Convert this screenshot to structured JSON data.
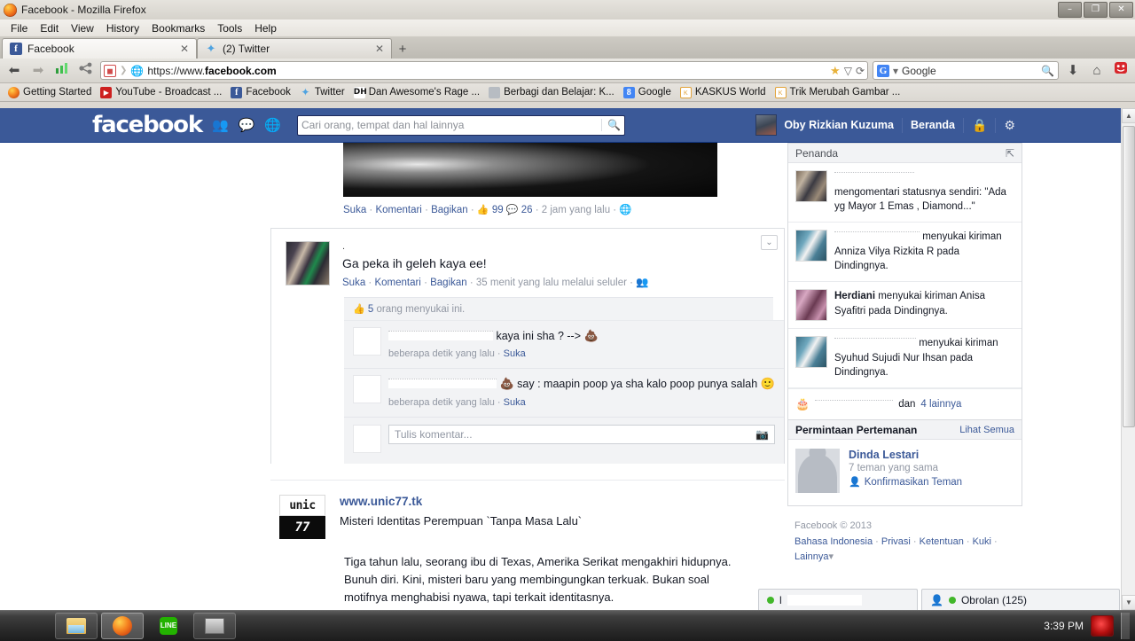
{
  "window": {
    "title": "Facebook - Mozilla Firefox",
    "minimize": "–",
    "maximize": "❐",
    "close": "✕"
  },
  "menubar": [
    "File",
    "Edit",
    "View",
    "History",
    "Bookmarks",
    "Tools",
    "Help"
  ],
  "tabs": [
    {
      "label": "Facebook",
      "icon": "facebook-icon",
      "close": "✕",
      "active": true
    },
    {
      "label": "(2) Twitter",
      "icon": "twitter-icon",
      "close": "✕",
      "active": false
    }
  ],
  "newtab_label": "+",
  "navbar": {
    "back": "⬅",
    "forward": "➡",
    "url": "https://www.",
    "url_bold": "facebook.com",
    "url_suffix": "",
    "identity_icon": "site-identity-icon",
    "star": "★",
    "dropmarker": "▽",
    "reload": "⟳",
    "search_engine": "Google",
    "search_icon": "magnifier-icon",
    "download": "⬇",
    "home": "⌂"
  },
  "bookmarks": [
    {
      "label": "Getting Started",
      "icon": "firefox-icon"
    },
    {
      "label": "YouTube - Broadcast ...",
      "icon": "youtube-icon"
    },
    {
      "label": "Facebook",
      "icon": "facebook-icon"
    },
    {
      "label": "Twitter",
      "icon": "twitter-icon"
    },
    {
      "label": "Dan Awesome's Rage ...",
      "icon": "rage-icon"
    },
    {
      "label": "Berbagi dan Belajar: K...",
      "icon": "blog-icon"
    },
    {
      "label": "Google",
      "icon": "google-icon"
    },
    {
      "label": "KASKUS World",
      "icon": "kaskus-icon"
    },
    {
      "label": "Trik Merubah Gambar ...",
      "icon": "kaskus-icon"
    }
  ],
  "fb_header": {
    "logo": "facebook",
    "icons": [
      "friend-requests-icon",
      "messages-icon",
      "notifications-icon"
    ],
    "search_placeholder": "Cari orang, tempat dan hal lainnya",
    "search_button": "search-icon",
    "user_name": "Oby Rizkian Kuzuma",
    "home_label": "Beranda",
    "privacy_icon": "privacy-lock-icon",
    "settings_icon": "gear-icon",
    "brand_color": "#3b5998"
  },
  "feed": {
    "photo_post": {
      "like": "Suka",
      "comment": "Komentari",
      "share": "Bagikan",
      "like_count": "99",
      "comment_count": "26",
      "time": "2 jam yang lalu",
      "privacy_icon": "globe-icon"
    },
    "status_post": {
      "dot": ".",
      "text": "Ga peka ih geleh kaya ee!",
      "like": "Suka",
      "comment": "Komentari",
      "share": "Bagikan",
      "time": "35 menit yang lalu melalui seluler",
      "privacy_icon": "friends-icon",
      "caret": "⌄",
      "likes_summary_count": "5",
      "likes_summary_text": " orang menyukai ini.",
      "comments": [
        {
          "author": "",
          "text": "kaya ini sha ? -->",
          "emoji": "💩",
          "time": "beberapa detik yang lalu",
          "like": "Suka"
        },
        {
          "author": "",
          "emoji": "💩",
          "text": "say : maapin poop ya sha kalo poop punya salah",
          "emoji2": "🙂",
          "time": "beberapa detik yang lalu",
          "like": "Suka"
        }
      ],
      "comment_placeholder": "Tulis komentar...",
      "camera_icon": "camera-icon"
    },
    "link_post": {
      "logo_top": "unic",
      "logo_bottom": "77",
      "url": "www.unic77.tk",
      "title": "Misteri Identitas Perempuan `Tanpa Masa Lalu`",
      "body": "Tiga tahun lalu, seorang ibu di Texas, Amerika Serikat mengakhiri hidupnya. Bunuh diri. Kini, misteri baru yang membingungkan terkuak. Bukan soal motifnya menghabisi nyawa, tapi terkait identitasnya."
    }
  },
  "ticker": {
    "title": "Penanda",
    "collapse_icon": "collapse-ticker-icon",
    "items": [
      {
        "actor": "",
        "text": "mengomentari statusnya sendiri: \"Ada yg Mayor 1 Emas , Diamond...\""
      },
      {
        "actor": "",
        "text": "menyukai kiriman Anniza Vilya Rizkita R pada Dindingnya."
      },
      {
        "actor": "Herdiani",
        "text": "menyukai kiriman Anisa Syafitri pada Dindingnya."
      },
      {
        "actor": "",
        "text": "menyukai kiriman Syuhud Sujudi Nur Ihsan pada Dindingnya."
      }
    ],
    "footer": {
      "icon": "birthday-cake-icon",
      "and": "dan",
      "more": "4 lainnya"
    }
  },
  "friend_requests": {
    "title": "Permintaan Pertemanan",
    "see_all": "Lihat Semua",
    "items": [
      {
        "name": "Dinda Lestari",
        "mutual": "7 teman yang sama",
        "confirm_icon": "add-friend-icon",
        "confirm": "Konfirmasikan Teman"
      }
    ]
  },
  "site_footer": {
    "copyright": "Facebook © 2013",
    "links": [
      "Bahasa Indonesia",
      "Privasi",
      "Ketentuan",
      "Kuki",
      "Lainnya"
    ],
    "more_caret": "▾"
  },
  "chatbar": {
    "left_pill": {
      "status_icon": "online-status-icon",
      "label": "l"
    },
    "right_pill": {
      "icon": "chat-people-icon",
      "label": "Obrolan (125)"
    }
  },
  "taskbar": {
    "items": [
      {
        "name": "explorer",
        "icon": "file-explorer-icon"
      },
      {
        "name": "firefox",
        "icon": "firefox-icon"
      },
      {
        "name": "line",
        "icon": "line-messenger-icon",
        "label": "LINE"
      },
      {
        "name": "screenshot",
        "icon": "screenshot-tool-icon"
      }
    ],
    "clock": "3:39 PM",
    "tray_icon": "tray-app-icon"
  }
}
